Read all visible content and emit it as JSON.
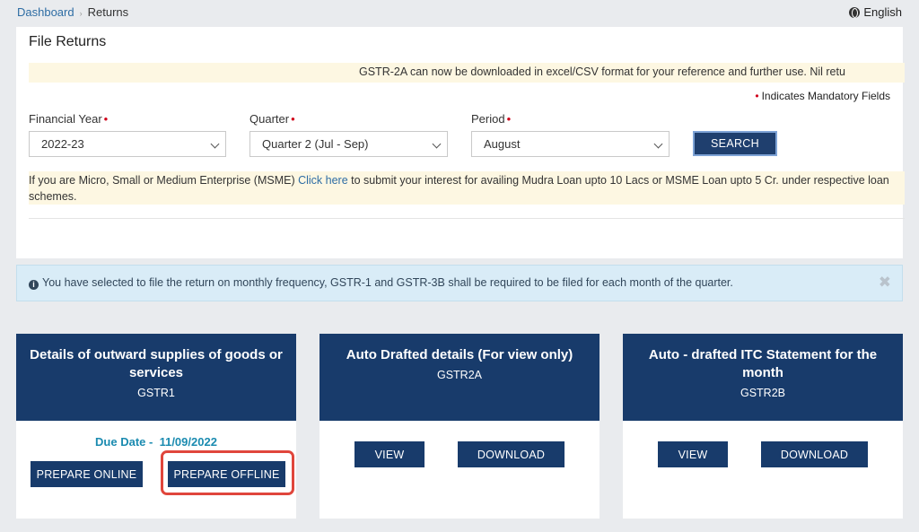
{
  "breadcrumb": {
    "home": "Dashboard",
    "current": "Returns"
  },
  "language": "English",
  "panel": {
    "title": "File Returns",
    "notice": "GSTR-2A can now be downloaded in excel/CSV format for your reference and further use. Nil retu",
    "mandatory": "Indicates Mandatory Fields"
  },
  "filters": {
    "financial_year": {
      "label": "Financial Year",
      "value": "2022-23"
    },
    "quarter": {
      "label": "Quarter",
      "value": "Quarter 2 (Jul - Sep)"
    },
    "period": {
      "label": "Period",
      "value": "August"
    },
    "required_mark": "•",
    "search_label": "SEARCH"
  },
  "msme": {
    "before": "If you are Micro, Small or Medium Enterprise (MSME) ",
    "link": "Click here",
    "after": " to submit your interest for availing Mudra Loan upto 10 Lacs or MSME Loan upto 5 Cr. under respective loan schemes."
  },
  "info_bar": {
    "icon": "i",
    "text": "You have selected to file the return on monthly frequency, GSTR-1 and GSTR-3B shall be required to be filed for each month of the quarter.",
    "close": "✖"
  },
  "cards": [
    {
      "title": "Details of outward supplies of goods or services",
      "code": "GSTR1",
      "due_label": "Due Date -",
      "due_date": "11/09/2022",
      "btn1": "PREPARE ONLINE",
      "btn2": "PREPARE OFFLINE"
    },
    {
      "title": "Auto Drafted details (For view only)",
      "code": "GSTR2A",
      "btn1": "VIEW",
      "btn2": "DOWNLOAD"
    },
    {
      "title": "Auto - drafted ITC Statement for the month",
      "code": "GSTR2B",
      "btn1": "VIEW",
      "btn2": "DOWNLOAD"
    }
  ],
  "colors": {
    "navy": "#183b6b",
    "accent_link": "#2e6da4",
    "due_teal": "#1b8bb0",
    "highlight_red": "#e0463c"
  }
}
